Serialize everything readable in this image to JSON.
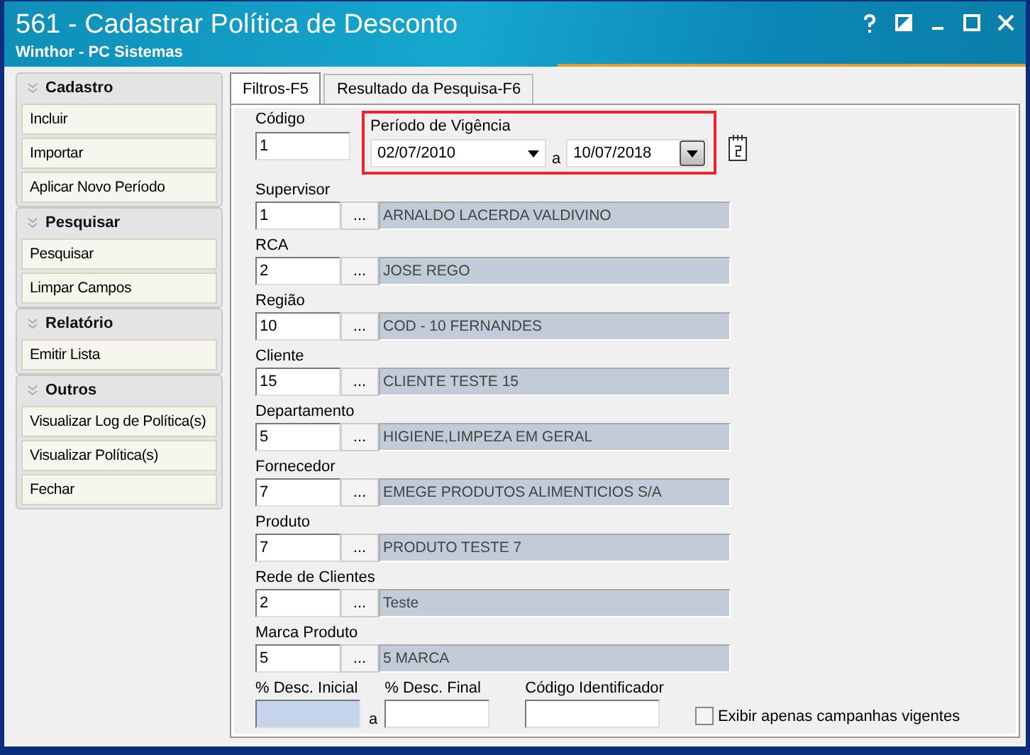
{
  "window": {
    "title": "561 - Cadastrar Política de Desconto",
    "subtitle": "Winthor - PC Sistemas"
  },
  "sidebar": {
    "groups": [
      {
        "title": "Cadastro",
        "items": [
          "Incluir",
          "Importar",
          "Aplicar Novo Período"
        ]
      },
      {
        "title": "Pesquisar",
        "items": [
          "Pesquisar",
          "Limpar Campos"
        ]
      },
      {
        "title": "Relatório",
        "items": [
          "Emitir Lista"
        ]
      },
      {
        "title": "Outros",
        "items": [
          "Visualizar Log de Política(s)",
          "Visualizar Política(s)",
          "Fechar"
        ]
      }
    ]
  },
  "tabs": [
    {
      "label": "Filtros-F5",
      "selected": true
    },
    {
      "label": "Resultado da Pesquisa-F6",
      "selected": false
    }
  ],
  "codigo": {
    "label": "Código",
    "value": "1"
  },
  "periodo": {
    "label": "Período de Vigência",
    "start": "02/07/2010",
    "separator": "a",
    "end": "10/07/2018",
    "highlighted": true
  },
  "lookups": [
    {
      "label": "Supervisor",
      "code": "1",
      "button": "...",
      "description": "ARNALDO LACERDA VALDIVINO"
    },
    {
      "label": "RCA",
      "code": "2",
      "button": "...",
      "description": "JOSE REGO"
    },
    {
      "label": "Região",
      "code": "10",
      "button": "...",
      "description": "COD - 10 FERNANDES"
    },
    {
      "label": "Cliente",
      "code": "15",
      "button": "...",
      "description": "CLIENTE TESTE 15"
    },
    {
      "label": "Departamento",
      "code": "5",
      "button": "...",
      "description": "HIGIENE,LIMPEZA EM GERAL"
    },
    {
      "label": "Fornecedor",
      "code": "7",
      "button": "...",
      "description": "EMEGE PRODUTOS ALIMENTICIOS S/A"
    },
    {
      "label": "Produto",
      "code": "7",
      "button": "...",
      "description": "PRODUTO TESTE 7"
    },
    {
      "label": "Rede de Clientes",
      "code": "2",
      "button": "...",
      "description": "Teste"
    },
    {
      "label": "Marca Produto",
      "code": "5",
      "button": "...",
      "description": "5 MARCA"
    }
  ],
  "desconto": {
    "inicial_label": "% Desc. Inicial",
    "separator": "a",
    "final_label": "% Desc. Final",
    "inicial_focused": true
  },
  "codigo_identificador": {
    "label": "Código Identificador"
  },
  "checkbox": {
    "label": "Exibir apenas campanhas vigentes",
    "checked": false
  }
}
